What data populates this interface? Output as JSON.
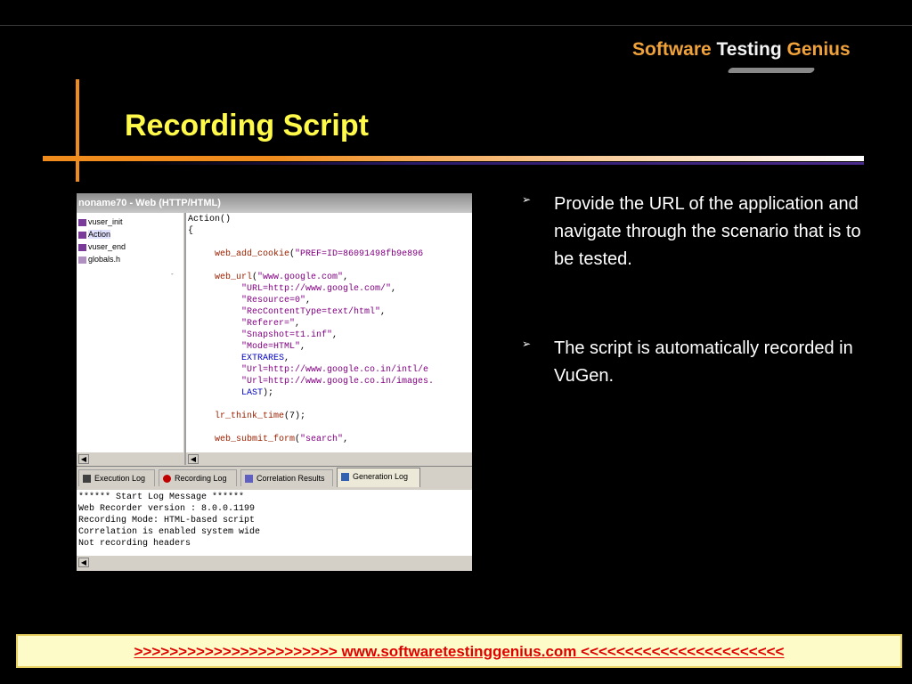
{
  "logo": {
    "word1": "Software",
    "word2": "Testing",
    "word3": "Genius"
  },
  "slide": {
    "title": "Recording Script"
  },
  "screenshot": {
    "window_title": "noname70 - Web (HTTP/HTML)",
    "tree": [
      {
        "label": "vuser_init",
        "icon": "script-file-icon"
      },
      {
        "label": "Action",
        "icon": "script-file-icon"
      },
      {
        "label": "vuser_end",
        "icon": "script-file-icon"
      },
      {
        "label": "globals.h",
        "icon": "header-file-icon"
      }
    ],
    "tree_dash": "-",
    "code": {
      "l1": "Action()",
      "l2": "{",
      "l3_fn": "web_add_cookie",
      "l3_arg": "\"PREF=ID=86091498fb9e896",
      "l4_fn": "web_url",
      "l4_arg": "\"www.google.com\"",
      "l5": "\"URL=http://www.google.com/\"",
      "l6": "\"Resource=0\"",
      "l7": "\"RecContentType=text/html\"",
      "l8": "\"Referer=\"",
      "l9": "\"Snapshot=t1.inf\"",
      "l10": "\"Mode=HTML\"",
      "l11": "EXTRARES",
      "l12": "\"Url=http://www.google.co.in/intl/e",
      "l13": "\"Url=http://www.google.co.in/images.",
      "l14": "LAST",
      "l15_fn": "lr_think_time",
      "l15_arg": "(7);",
      "l16_fn": "web_submit_form",
      "l16_arg": "\"search\""
    },
    "tabs": [
      "Execution Log",
      "Recording Log",
      "Correlation Results",
      "Generation Log"
    ],
    "active_tab": "Generation Log",
    "log_lines": [
      "****** Start Log Message ******",
      "Web Recorder version : 8.0.0.1199",
      "Recording Mode: HTML-based script",
      "Correlation is enabled system wide",
      "Not recording headers"
    ]
  },
  "bullets": [
    {
      "marker": "➢",
      "text": "Provide the URL of the application and navigate through the scenario that is to be tested."
    },
    {
      "marker": "➢",
      "text": "The script is automatically recorded in VuGen."
    }
  ],
  "footer": {
    "text": ">>>>>>>>>>>>>>>>>>>>>>>  www.softwaretestinggenius.com  <<<<<<<<<<<<<<<<<<<<<<<"
  },
  "colors": {
    "background": "#000000",
    "title": "#fff94a",
    "accent": "#f08c1e",
    "footer_text": "#e00000",
    "footer_bg": "#fdfcc8"
  }
}
